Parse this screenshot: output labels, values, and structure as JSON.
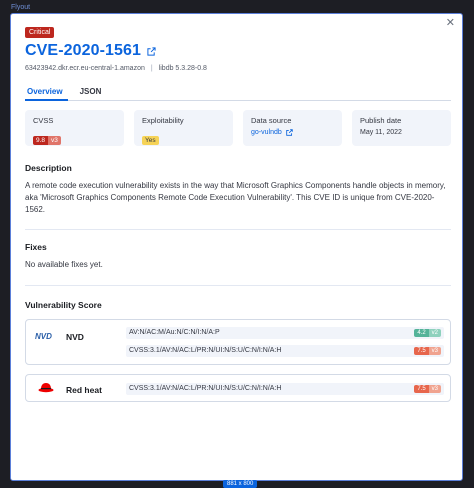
{
  "frame": {
    "label": "Flyout",
    "size_label": "881 x 800"
  },
  "header": {
    "severity": "Critical",
    "cve_id": "CVE-2020-1561",
    "image": "63423942.dkr.ecr.eu-central-1.amazon",
    "package": "libdb 5.3.28-0.8"
  },
  "tabs": [
    {
      "label": "Overview",
      "active": true
    },
    {
      "label": "JSON",
      "active": false
    }
  ],
  "cards": {
    "cvss": {
      "label": "CVSS",
      "score": "9.8",
      "version": "v3"
    },
    "exploitability": {
      "label": "Exploitability",
      "value": "Yes"
    },
    "data_source": {
      "label": "Data source",
      "value": "go-vulndb"
    },
    "publish_date": {
      "label": "Publish date",
      "value": "May 11, 2022"
    }
  },
  "description": {
    "title": "Description",
    "text": "A remote code execution vulnerability exists in the way that Microsoft Graphics Components handle objects in memory, aka 'Microsoft Graphics Components Remote Code Execution Vulnerability'. This CVE ID is unique from CVE-2020-1562."
  },
  "fixes": {
    "title": "Fixes",
    "text": "No available fixes yet."
  },
  "vulnerability_score": {
    "title": "Vulnerability Score",
    "sources": [
      {
        "logo": "NVD",
        "name": "NVD",
        "vectors": [
          {
            "vector": "AV:N/AC:M/Au:N/C:N/I:N/A:P",
            "score": "4.2",
            "version": "v2"
          },
          {
            "vector": "CVSS:3.1/AV:N/AC:L/PR:N/UI:N/S:U/C:N/I:N/A:H",
            "score": "7.5",
            "version": "v3"
          }
        ]
      },
      {
        "logo": "red-hat-icon",
        "name": "Red heat",
        "vectors": [
          {
            "vector": "CVSS:3.1/AV:N/AC:L/PR:N/UI:N/S:U/C:N/I:N/A:H",
            "score": "7.5",
            "version": "v3"
          }
        ]
      }
    ]
  },
  "colors": {
    "accent": "#0b64dd",
    "critical": "#bd271e",
    "yes_badge": "#f6d357"
  }
}
